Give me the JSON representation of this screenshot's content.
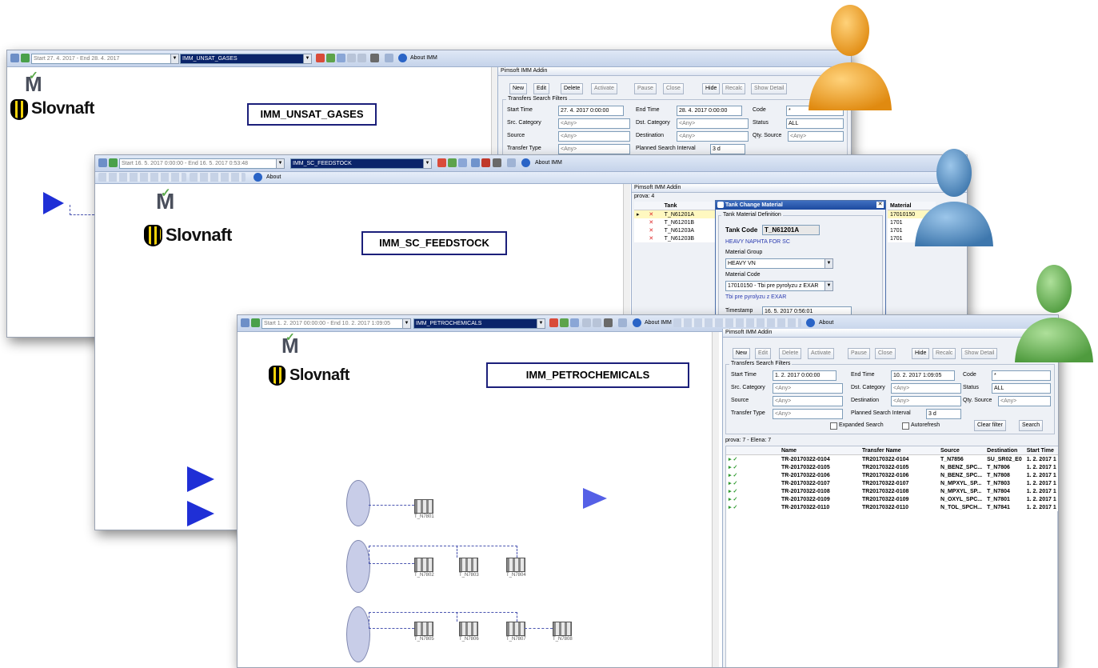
{
  "win1": {
    "range_text": "Start 27. 4. 2017 - End 28. 4. 2017",
    "plant_selector": "IMM_UNSAT_GASES",
    "about": "About IMM",
    "label": "IMM_UNSAT_GASES",
    "logo": "Slovnaft",
    "panel": {
      "title": "Pimsoft IMM Addin",
      "buttons": [
        "New",
        "Edit",
        "Delete",
        "Activate",
        "Pause",
        "Close",
        "Hide",
        "Recalc",
        "Show Detail"
      ],
      "group_title": "Transfers Search Filters",
      "start_time_label": "Start Time",
      "start_time": "27. 4. 2017 0:00:00",
      "end_time_label": "End Time",
      "end_time": "28. 4. 2017 0:00:00",
      "code_label": "Code",
      "code": "*",
      "src_cat_label": "Src. Category",
      "src_cat": "<Any>",
      "dst_cat_label": "Dst. Category",
      "dst_cat": "<Any>",
      "status_label": "Status",
      "status": "ALL",
      "source_label": "Source",
      "source": "<Any>",
      "destination_label": "Destination",
      "destination": "<Any>",
      "qty_source_label": "Qty. Source",
      "qty_source": "<Any>",
      "transfer_type_label": "Transfer Type",
      "transfer_type": "<Any>",
      "planned_label": "Planned Search Interval",
      "planned": "3 d"
    }
  },
  "win2": {
    "range_text": "Start 16. 5. 2017 0:00:00 - End 16. 5. 2017 0:53:48",
    "plant_selector": "IMM_SC_FEEDSTOCK",
    "about": "About IMM",
    "about2": "About",
    "label": "IMM_SC_FEEDSTOCK",
    "logo": "Slovnaft",
    "panel": {
      "title": "Pimsoft IMM Addin",
      "grid_caption": "prova: 4",
      "col_tank": "Tank",
      "col_material": "Material",
      "rows": [
        "T_N61201A",
        "T_N61201B",
        "T_N61203A",
        "T_N61203B"
      ],
      "materials": [
        "17010150",
        "1701",
        "1701",
        "1701"
      ]
    },
    "dialog": {
      "title": "Tank Change Material",
      "group_title": "Tank Material Definition",
      "tank_code_label": "Tank Code",
      "tank_code": "T_N61201A",
      "tank_desc": "HEAVY NAPHTA FOR SC",
      "material_group_label": "Material Group",
      "material_group": "HEAVY VN",
      "material_code_label": "Material Code",
      "material_code": "17010150 - Tbi  pre pyrolyzu z  EXAR",
      "material_desc": "Tbi  pre pyrolyzu z  EXAR",
      "timestamp_label": "Timestamp",
      "timestamp": "16. 5. 2017  0:56:01"
    }
  },
  "win3": {
    "range_text": "Start 1. 2. 2017 00:00:00 - End 10. 2. 2017 1:09:05",
    "plant_selector": "IMM_PETROCHEMICALS",
    "about": "About IMM",
    "about2": "About",
    "label": "IMM_PETROCHEMICALS",
    "logo": "Slovnaft",
    "tanks": [
      "T_N7801",
      "T_N7802",
      "T_N7803",
      "T_N7804",
      "T_N7805",
      "T_N7806",
      "T_N7807",
      "T_N7808"
    ],
    "panel": {
      "title": "Pimsoft IMM Addin",
      "buttons": [
        "New",
        "Edit",
        "Delete",
        "Activate",
        "Pause",
        "Close",
        "Hide",
        "Recalc",
        "Show Detail"
      ],
      "group_title": "Transfers Search Filters",
      "start_time_label": "Start Time",
      "start_time": "1. 2. 2017 0:00:00",
      "end_time_label": "End Time",
      "end_time": "10. 2. 2017 1:09:05",
      "code_label": "Code",
      "code": "*",
      "src_cat_label": "Src. Category",
      "src_cat": "<Any>",
      "dst_cat_label": "Dst. Category",
      "dst_cat": "<Any>",
      "status_label": "Status",
      "status": "ALL",
      "source_label": "Source",
      "source": "<Any>",
      "destination_label": "Destination",
      "destination": "<Any>",
      "qty_source_label": "Qty. Source",
      "qty_source": "<Any>",
      "transfer_type_label": "Transfer Type",
      "transfer_type": "<Any>",
      "planned_label": "Planned Search Interval",
      "planned": "3 d",
      "expanded_search": "Expanded Search",
      "autorefresh": "Autorefresh",
      "clear_filters": "Clear filter",
      "search": "Search",
      "grid_caption": "prova: 7 - Elena: 7",
      "columns": [
        "Name",
        "Transfer Name",
        "Source",
        "Destination",
        "Start Time"
      ],
      "rows": [
        [
          "TR-20170322-0104",
          "TR20170322-0104",
          "T_N7856",
          "SU_SR02_E0",
          "1. 2. 2017 1"
        ],
        [
          "TR-20170322-0105",
          "TR20170322-0105",
          "N_BENZ_SPC...",
          "T_N7806",
          "1. 2. 2017 1"
        ],
        [
          "TR-20170322-0106",
          "TR20170322-0106",
          "N_BENZ_SPC...",
          "T_N7808",
          "1. 2. 2017 1"
        ],
        [
          "TR-20170322-0107",
          "TR20170322-0107",
          "N_MPXYL_SP...",
          "T_N7803",
          "1. 2. 2017 1"
        ],
        [
          "TR-20170322-0108",
          "TR20170322-0108",
          "N_MPXYL_SP...",
          "T_N7804",
          "1. 2. 2017 1"
        ],
        [
          "TR-20170322-0109",
          "TR20170322-0109",
          "N_OXYL_SPC...",
          "T_N7801",
          "1. 2. 2017 1"
        ],
        [
          "TR-20170322-0110",
          "TR20170322-0110",
          "N_TOL_SPCH...",
          "T_N7841",
          "1. 2. 2017 1"
        ]
      ]
    }
  },
  "avatars": [
    {
      "name": "user-orange",
      "color": "#f5b335"
    },
    {
      "name": "user-blue",
      "color": "#5b93c4"
    },
    {
      "name": "user-green",
      "color": "#6fb45a"
    }
  ],
  "colors": {
    "triangle": "#1f2fd6",
    "label_border": "#1b1f7a",
    "selection": "#0a246a",
    "check": "#2e9a2e",
    "x_mark": "#d22"
  }
}
